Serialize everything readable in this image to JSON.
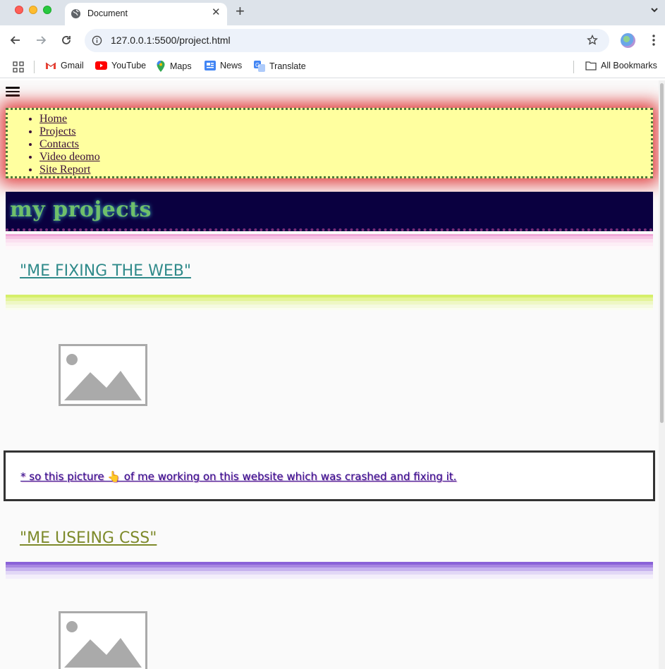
{
  "browser": {
    "tab_title": "Document",
    "url": "127.0.0.1:5500/project.html",
    "bookmarks": [
      {
        "label": "Gmail",
        "icon": "gmail-icon"
      },
      {
        "label": "YouTube",
        "icon": "youtube-icon"
      },
      {
        "label": "Maps",
        "icon": "maps-icon"
      },
      {
        "label": "News",
        "icon": "news-icon"
      },
      {
        "label": "Translate",
        "icon": "translate-icon"
      }
    ],
    "all_bookmarks": "All Bookmarks"
  },
  "page": {
    "nav_items": [
      "Home",
      "Projects",
      "Contacts",
      "Video deomo",
      "Site Report"
    ],
    "banner_title": "my projects",
    "sections": [
      {
        "title": "\"ME FIXING THE WEB\"",
        "caption": "* so this picture 👆 of me working on this website which was crashed and fixing it."
      },
      {
        "title": "\"ME USEING CSS\""
      }
    ]
  },
  "colors": {
    "nav_background": "#ffff9f",
    "nav_glow": "#dc1e1e",
    "banner_background": "#0a0040",
    "banner_text": "#6fbf6a"
  }
}
